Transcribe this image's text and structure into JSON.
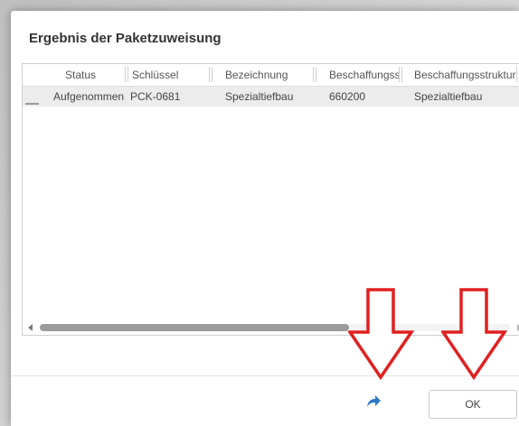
{
  "dialog": {
    "title": "Ergebnis der Paketzuweisung"
  },
  "table": {
    "columns": [
      "Status",
      "Schlüssel",
      "Bezeichnung",
      "Beschaffungsst",
      "Beschaffungsstruktur"
    ],
    "rows": [
      [
        "Aufgenommen",
        "PCK-0681",
        "Spezialtiefbau",
        "660200",
        "Spezialtiefbau"
      ]
    ]
  },
  "footer": {
    "ok_label": "OK",
    "share_icon": "share-arrow-icon"
  },
  "colors": {
    "accent_blue": "#2b78c5",
    "annotation_red": "#e02020"
  }
}
